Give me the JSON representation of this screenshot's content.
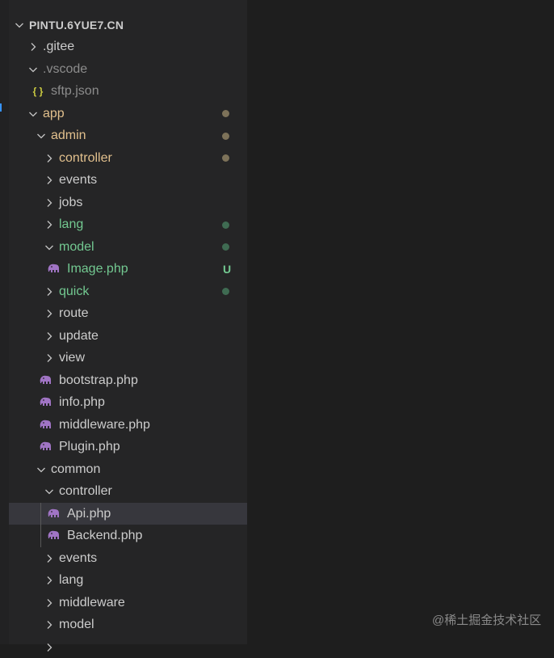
{
  "colors": {
    "modified": "#e2c08d",
    "untracked": "#73c991",
    "ignored": "#8c8c8c",
    "normal": "#cccccc",
    "dot_modified": "#7d7259",
    "dot_untracked": "#3f6b52",
    "json": "#cbcb41",
    "php": "#a074c4"
  },
  "explorer": {
    "rows": [
      {
        "label": "PINTU.6YUE7.CN",
        "type": "root",
        "depth": 0,
        "expanded": true
      },
      {
        "label": ".gitee",
        "type": "folder",
        "depth": 1,
        "expanded": false
      },
      {
        "label": ".vscode",
        "type": "folder",
        "depth": 1,
        "expanded": true,
        "status": "ignored"
      },
      {
        "label": "sftp.json",
        "type": "json",
        "depth": 2,
        "status": "ignored",
        "icon": "json-braces-icon",
        "icon_text": "{ }"
      },
      {
        "label": "app",
        "type": "folder",
        "depth": 1,
        "expanded": true,
        "status": "modified",
        "decoration": "dot"
      },
      {
        "label": "admin",
        "type": "folder",
        "depth": 2,
        "expanded": true,
        "status": "modified",
        "decoration": "dot"
      },
      {
        "label": "controller",
        "type": "folder",
        "depth": 3,
        "expanded": false,
        "status": "modified",
        "decoration": "dot"
      },
      {
        "label": "events",
        "type": "folder",
        "depth": 3,
        "expanded": false
      },
      {
        "label": "jobs",
        "type": "folder",
        "depth": 3,
        "expanded": false
      },
      {
        "label": "lang",
        "type": "folder",
        "depth": 3,
        "expanded": false,
        "status": "untracked",
        "decoration": "dot"
      },
      {
        "label": "model",
        "type": "folder",
        "depth": 3,
        "expanded": true,
        "status": "untracked",
        "decoration": "dot"
      },
      {
        "label": "Image.php",
        "type": "php",
        "depth": 4,
        "status": "untracked",
        "decoration": "U"
      },
      {
        "label": "quick",
        "type": "folder",
        "depth": 3,
        "expanded": false,
        "status": "untracked",
        "decoration": "dot"
      },
      {
        "label": "route",
        "type": "folder",
        "depth": 3,
        "expanded": false
      },
      {
        "label": "update",
        "type": "folder",
        "depth": 3,
        "expanded": false
      },
      {
        "label": "view",
        "type": "folder",
        "depth": 3,
        "expanded": false
      },
      {
        "label": "bootstrap.php",
        "type": "php",
        "depth": 3
      },
      {
        "label": "info.php",
        "type": "php",
        "depth": 3
      },
      {
        "label": "middleware.php",
        "type": "php",
        "depth": 3
      },
      {
        "label": "Plugin.php",
        "type": "php",
        "depth": 3
      },
      {
        "label": "common",
        "type": "folder",
        "depth": 2,
        "expanded": true
      },
      {
        "label": "controller",
        "type": "folder",
        "depth": 3,
        "expanded": true
      },
      {
        "label": "Api.php",
        "type": "php",
        "depth": 4,
        "selected": true
      },
      {
        "label": "Backend.php",
        "type": "php",
        "depth": 4
      },
      {
        "label": "events",
        "type": "folder",
        "depth": 3,
        "expanded": false
      },
      {
        "label": "lang",
        "type": "folder",
        "depth": 3,
        "expanded": false
      },
      {
        "label": "middleware",
        "type": "folder",
        "depth": 3,
        "expanded": false
      },
      {
        "label": "model",
        "type": "folder",
        "depth": 3,
        "expanded": false
      },
      {
        "label": "",
        "type": "folder",
        "depth": 3,
        "expanded": false
      }
    ]
  },
  "watermark": "@稀土掘金技术社区"
}
